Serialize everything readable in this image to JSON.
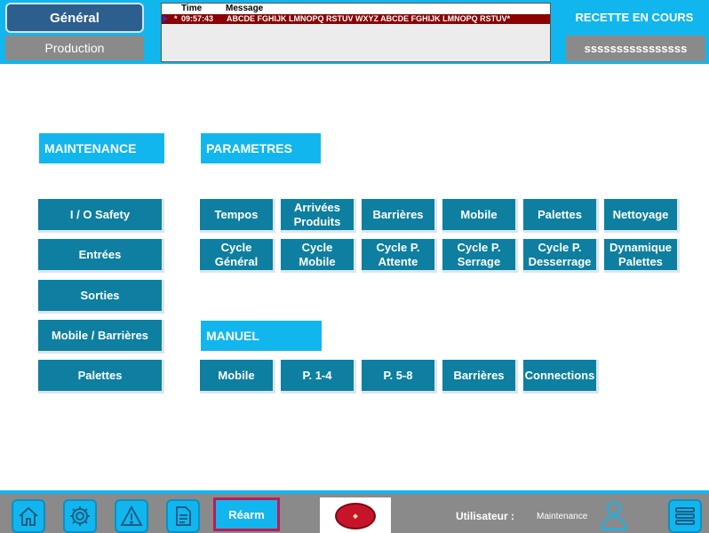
{
  "header": {
    "tab_general": "Général",
    "tab_production": "Production",
    "alarm_table": {
      "col_time": "Time",
      "col_message": "Message",
      "rows": [
        {
          "flag": "*",
          "time": "09:57:43",
          "message": "ABCDE FGHIJK LMNOPQ RSTUV WXYZ ABCDE FGHIJK LMNOPQ RSTUV*"
        }
      ]
    },
    "status": "RECETTE EN COURS",
    "field_value": "ssssssssssssssss"
  },
  "sections": {
    "maintenance": "MAINTENANCE",
    "parametres": "PARAMETRES",
    "manuel": "MANUEL"
  },
  "maintenance_buttons": [
    "I / O Safety",
    "Entrées",
    "Sorties",
    "Mobile / Barrières",
    "Palettes"
  ],
  "parametres_row1": [
    "Tempos",
    "Arrivées\nProduits",
    "Barrières",
    "Mobile",
    "Palettes",
    "Nettoyage"
  ],
  "parametres_row2": [
    "Cycle\nGénéral",
    "Cycle\nMobile",
    "Cycle P.\nAttente",
    "Cycle P.\nSerrage",
    "Cycle P.\nDesserrage",
    "Dynamique\nPalettes"
  ],
  "manuel_buttons": [
    "Mobile",
    "P. 1-4",
    "P. 5-8",
    "Barrières",
    "Connections"
  ],
  "footer": {
    "icons": [
      "home-icon",
      "gear-icon",
      "warning-icon",
      "document-icon"
    ],
    "rearm_label": "Réarm",
    "user_label": "Utilisateur :",
    "user_value": "Maintenance",
    "menu_icon": "hamburger-icon"
  },
  "colors": {
    "accent": "#12b6ee",
    "button": "#0e7fa0",
    "alarm_row": "#8b0000",
    "gray": "#8a8a8a",
    "rearm_border": "#b81d5a"
  }
}
